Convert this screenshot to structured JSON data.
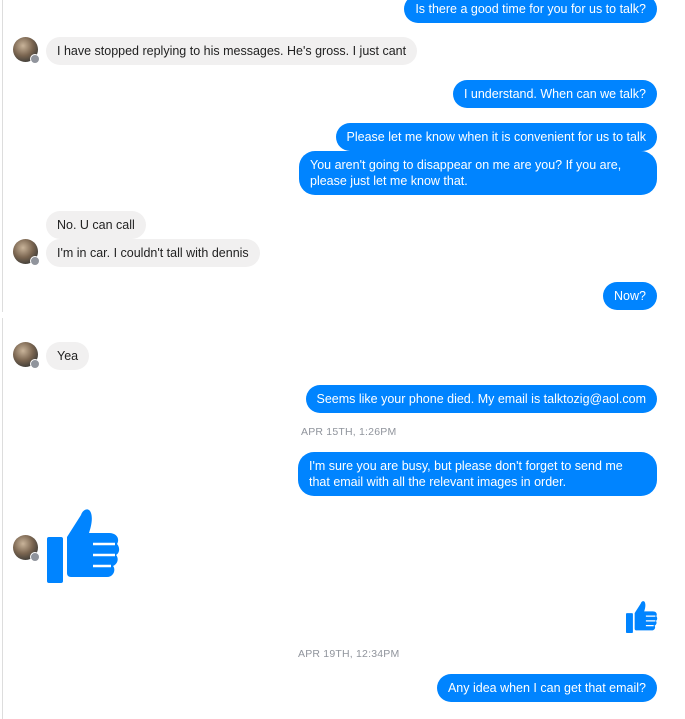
{
  "messages": {
    "m1": "Is there a good time for you for us to talk?",
    "m2": "I have stopped replying to his messages. He's gross. I just cant",
    "m3": "I understand. When can we talk?",
    "m4": "Please let me know when it is convenient for us to talk",
    "m5": "You aren't going to disappear on me are you? If you are, please just let me know that.",
    "m6": "No. U can call",
    "m7": "I'm in car. I couldn't tall with dennis",
    "m8": "Now?",
    "m9": "Yea",
    "m10": "Seems like your phone died. My email is talktozig@aol.com",
    "m11": "I'm sure you are busy, but please don't forget to send me that email with all the relevant images in order.",
    "m12": "Any idea when I can get that email?"
  },
  "timestamps": {
    "t1": "APR 15TH, 1:26PM",
    "t2": "APR 19TH, 12:34PM"
  },
  "colors": {
    "outgoing": "#0084ff",
    "incoming": "#f1f0f0",
    "timestamp": "#90949c"
  },
  "icons": [
    "thumbs-up-icon",
    "avatar"
  ]
}
